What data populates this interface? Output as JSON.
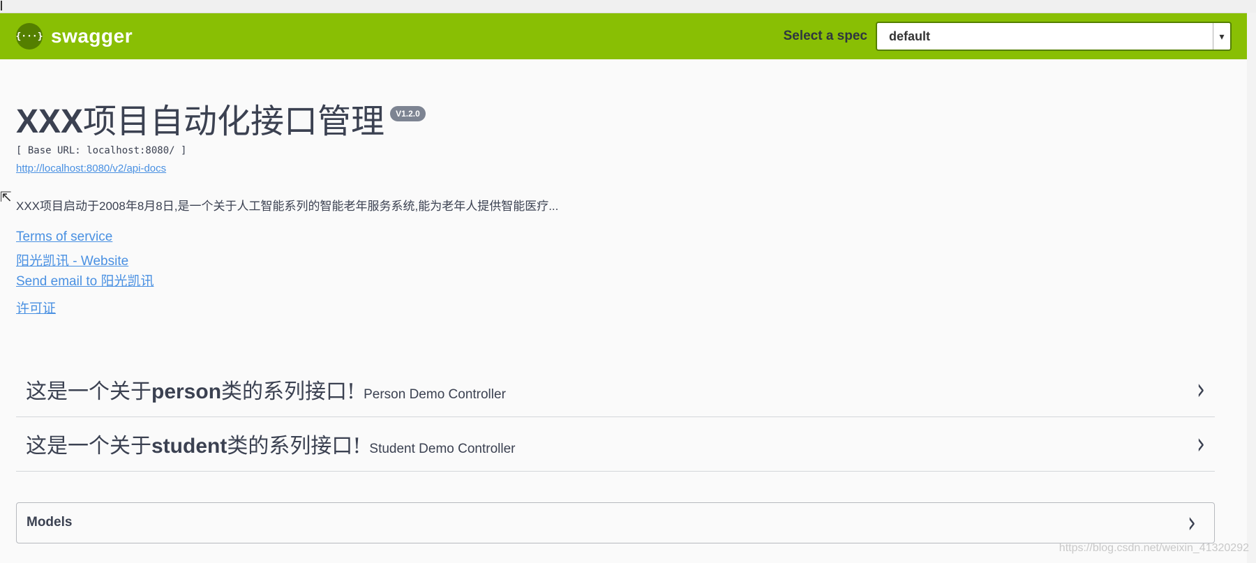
{
  "header": {
    "brand": "swagger",
    "logo_glyph": "{···}",
    "spec_label": "Select a spec",
    "spec_selected": "default"
  },
  "info": {
    "title_latin": "XXX",
    "title_cn": "项目自动化接口管理",
    "version": "V1.2.0",
    "base_url": "[ Base URL: localhost:8080/ ]",
    "api_docs_link": "http://localhost:8080/v2/api-docs",
    "description": "XXX项目启动于2008年8月8日,是一个关于人工智能系列的智能老年服务系统,能为老年人提供智能医疗...",
    "links": {
      "terms": "Terms of service",
      "website": "阳光凯讯 - Website",
      "email": "Send email to 阳光凯讯",
      "license": "许可证"
    }
  },
  "tags": [
    {
      "title_pre": "这是一个关于",
      "title_bold": "person",
      "title_post": "类的系列接口!",
      "desc": "Person Demo Controller"
    },
    {
      "title_pre": "这是一个关于",
      "title_bold": "student",
      "title_post": "类的系列接口!",
      "desc": "Student Demo Controller"
    }
  ],
  "models": {
    "label": "Models"
  },
  "watermark": "https://blog.csdn.net/weixin_41320292",
  "colors": {
    "topbar": "#89bf04",
    "link": "#4990e2",
    "text": "#3b4151"
  }
}
